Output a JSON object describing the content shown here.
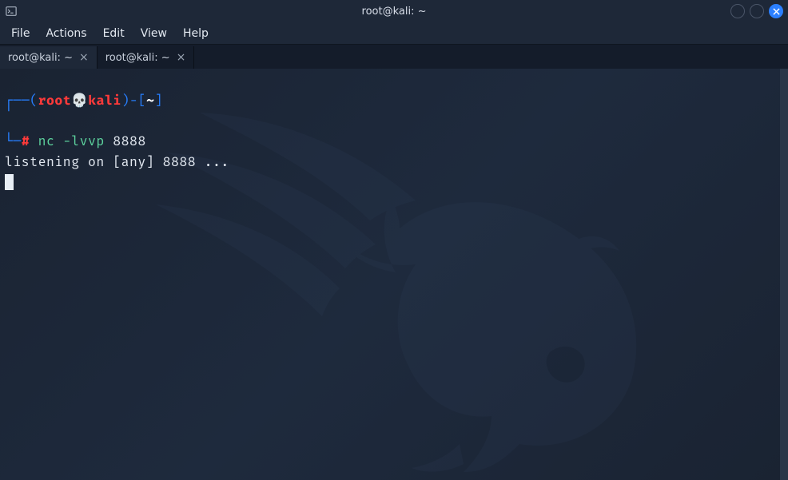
{
  "window": {
    "title": "root@kali: ~"
  },
  "menubar": {
    "items": [
      "File",
      "Actions",
      "Edit",
      "View",
      "Help"
    ]
  },
  "tabs": [
    {
      "label": "root@kali: ~",
      "active": true
    },
    {
      "label": "root@kali: ~",
      "active": false
    }
  ],
  "prompt": {
    "corner_top": "┌──",
    "paren_open": "(",
    "user": "root",
    "skull": "💀",
    "host": "kali",
    "paren_close": ")",
    "dash": "-",
    "bracket_open": "[",
    "cwd": "~",
    "bracket_close": "]",
    "corner_bottom": "└─",
    "hash": "#"
  },
  "command": {
    "cmd": "nc -lvvp",
    "arg": "8888"
  },
  "output": {
    "line1": "listening on [any] 8888 ..."
  }
}
